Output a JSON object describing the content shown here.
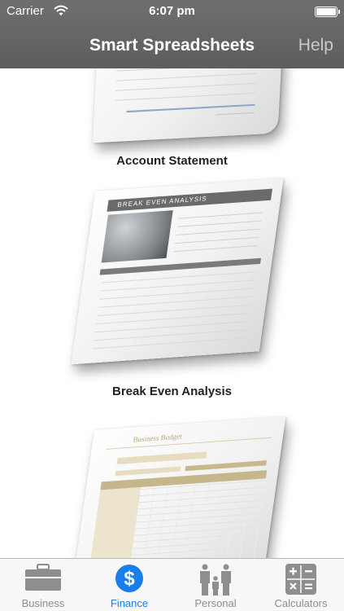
{
  "status_bar": {
    "carrier": "Carrier",
    "time": "6:07 pm"
  },
  "nav": {
    "title": "Smart Spreadsheets",
    "help_label": "Help"
  },
  "documents": [
    {
      "label": "Account Statement"
    },
    {
      "label": "Break Even Analysis",
      "sheet_title": "BREAK EVEN ANALYSIS"
    },
    {
      "label": "",
      "sheet_title": "Business Budget"
    }
  ],
  "tabs": [
    {
      "label": "Business",
      "icon": "briefcase-icon"
    },
    {
      "label": "Finance",
      "icon": "dollar-icon",
      "active": true
    },
    {
      "label": "Personal",
      "icon": "family-icon"
    },
    {
      "label": "Calculators",
      "icon": "calculator-icon"
    }
  ],
  "colors": {
    "nav_bg": "#636363",
    "active_tab": "#1a7ee8",
    "inactive_tab": "#8e8e8e"
  }
}
